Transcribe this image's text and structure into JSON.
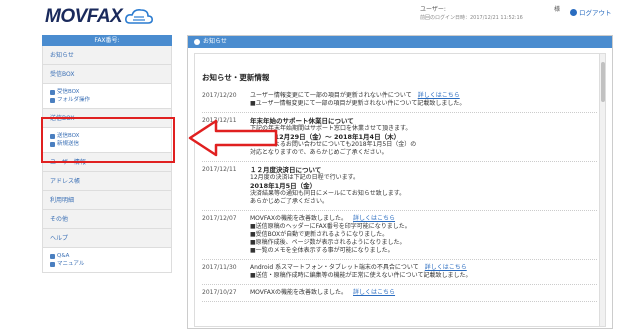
{
  "header": {
    "logo_text": "MOVFAX",
    "user_label": "ユーザー:",
    "user_suffix": "様",
    "last_login": "前回のログイン日時：2017/12/21 11:52:16",
    "logout": "ログアウト"
  },
  "sidebar": {
    "title": "FAX番号:",
    "items": [
      {
        "label": "お知らせ"
      },
      {
        "label": "受信BOX",
        "sub": [
          "受信BOX",
          "フォルダ操作"
        ]
      },
      {
        "label": "送信BOX",
        "sub": [
          "送信BOX",
          "新規送信"
        ]
      },
      {
        "label": "ユーザー情報"
      },
      {
        "label": "アドレス帳"
      },
      {
        "label": "利用明細"
      },
      {
        "label": "その他"
      },
      {
        "label": "ヘルプ",
        "sub": [
          "Q&A",
          "マニュアル"
        ]
      }
    ]
  },
  "panel": {
    "title": "お知らせ",
    "section_title": "お知らせ・更新情報",
    "news": [
      {
        "date": "2017/12/20",
        "lines": [
          "ユーザー情報変更にて一部の項目が更新されない件について",
          "■ユーザー情報変更にて一部の項目が更新されない件について記載致しました。"
        ],
        "link": "詳しくはこちら"
      },
      {
        "date": "2017/12/11",
        "lines": [
          "年末年始のサポート休業日について",
          "下記の年末年始期間はサポート窓口を休業させて頂きます。",
          "2017年12月29日（金）〜 2018年1月4日（木）",
          "メールによるお問い合わせについても2018年1月5日（金）の",
          "対応となりますので、あらかじめご了承ください。"
        ]
      },
      {
        "date": "2017/12/11",
        "lines": [
          "１２月度決済日について",
          "12月度の決済は下記の日程で行います。",
          "2018年1月5日（金）",
          "決済結果等の通知も同日にメールにてお知らせ致します。",
          "あらかじめご了承ください。"
        ]
      },
      {
        "date": "2017/12/07",
        "lines": [
          "MOVFAXの機能を改善致しました。",
          "■送信原稿のヘッダーにFAX番号を印字可能になりました。",
          "■受信BOXが自動で更新されるようになりました。",
          "■原稿作成後、ページ数が表示されるようになりました。",
          "■一覧のメモを全体表示する事が可能になりました。"
        ],
        "link": "詳しくはこちら"
      },
      {
        "date": "2017/11/30",
        "lines": [
          "Android 系スマートフォン・タブレット端末の不具合について",
          "■送信・原稿作成時に編集等の機能が正常に使えない件について記載致しました。"
        ],
        "link": "詳しくはこちら"
      },
      {
        "date": "2017/10/27",
        "lines": [
          "MOVFAXの機能を改善致しました。"
        ],
        "link": "詳しくはこちら"
      }
    ]
  }
}
